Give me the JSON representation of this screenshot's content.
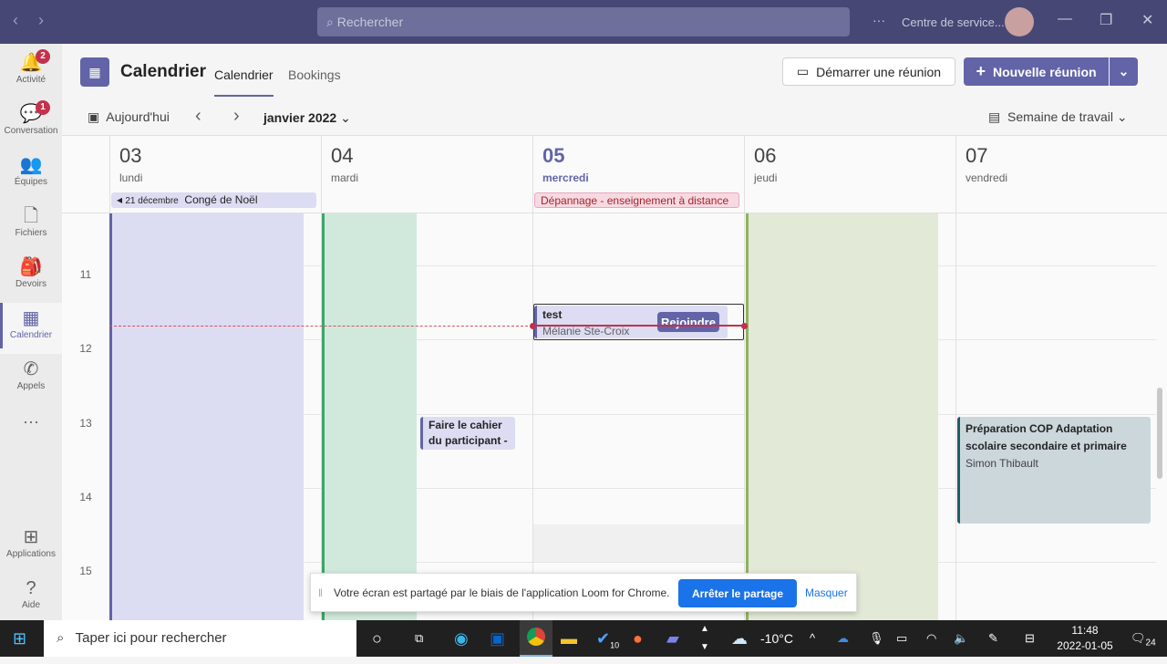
{
  "topbar": {
    "search_placeholder": "Rechercher",
    "org": "Centre de service...",
    "more": "···"
  },
  "rail": [
    {
      "label": "Activité",
      "icon": "bell-icon",
      "glyph": "🔔",
      "badge": "2"
    },
    {
      "label": "Conversation",
      "icon": "chat-icon",
      "glyph": "💬",
      "badge": "1"
    },
    {
      "label": "Équipes",
      "icon": "teams-icon",
      "glyph": "👥"
    },
    {
      "label": "Fichiers",
      "icon": "file-icon",
      "glyph": "🗋"
    },
    {
      "label": "Devoirs",
      "icon": "backpack-icon",
      "glyph": "🎒"
    },
    {
      "label": "Calendrier",
      "icon": "calendar-icon",
      "glyph": "▦"
    },
    {
      "label": "Appels",
      "icon": "phone-icon",
      "glyph": "✆"
    },
    {
      "label": "Applications",
      "icon": "apps-icon",
      "glyph": "⊞"
    },
    {
      "label": "Aide",
      "icon": "help-icon",
      "glyph": "?"
    }
  ],
  "header": {
    "title": "Calendrier",
    "tabs": [
      "Calendrier",
      "Bookings"
    ],
    "start_meeting": "Démarrer une réunion",
    "new_meeting": "Nouvelle réunion"
  },
  "toolbar": {
    "today": "Aujourd'hui",
    "month": "janvier 2022",
    "view": "Semaine de travail"
  },
  "days": [
    {
      "num": "03",
      "name": "lundi"
    },
    {
      "num": "04",
      "name": "mardi"
    },
    {
      "num": "05",
      "name": "mercredi"
    },
    {
      "num": "06",
      "name": "jeudi"
    },
    {
      "num": "07",
      "name": "vendredi"
    }
  ],
  "allday": [
    {
      "date": "21 décembre",
      "title": "Congé de Noël"
    },
    {
      "title": "Dépannage - enseignement à distance"
    }
  ],
  "hours": [
    "11",
    "12",
    "13",
    "14",
    "15"
  ],
  "events": {
    "test": {
      "title": "test",
      "organizer": "Mélanie Ste-Croix",
      "join": "Rejoindre"
    },
    "cahier": {
      "title": "Faire le cahier du participant -"
    },
    "cop": {
      "title": "Préparation COP Adaptation scolaire secondaire et primaire",
      "organizer": "Simon Thibault"
    }
  },
  "share_banner": {
    "text": "Votre écran est partagé par le biais de l'application Loom for Chrome.",
    "stop": "Arrêter le partage",
    "hide": "Masquer"
  },
  "taskbar": {
    "search": "Taper ici pour rechercher",
    "weather": "-10°C",
    "time": "11:48",
    "date": "2022-01-05",
    "notif": "24",
    "outlook_badge": "10"
  }
}
